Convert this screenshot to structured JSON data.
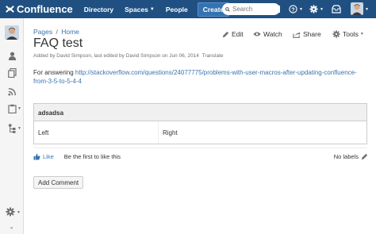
{
  "topnav": {
    "logo_text": "Confluence",
    "directory": "Directory",
    "spaces": "Spaces",
    "people": "People",
    "create": "Create",
    "search_placeholder": "Search"
  },
  "breadcrumb": {
    "pages": "Pages",
    "sep": "/",
    "home": "Home"
  },
  "page": {
    "title": "FAQ test",
    "byline": "Added by David Simpson, last edited by David Simpson on Jun 06, 2014",
    "translate": "Translate"
  },
  "actions": {
    "edit": "Edit",
    "watch": "Watch",
    "share": "Share",
    "tools": "Tools"
  },
  "content": {
    "prefix": "For answering",
    "link": "http://stackoverflow.com/questions/24077775/problems-with-user-macros-after-updating-confluence-from-3-5-to-5-4-4"
  },
  "table": {
    "header": "adsadsa",
    "left": "Left",
    "right": "Right"
  },
  "likes": {
    "like": "Like",
    "first": "Be the first to like this"
  },
  "labels": {
    "no_labels": "No labels"
  },
  "comments": {
    "add": "Add Comment"
  },
  "colors": {
    "topnav_bg": "#205081",
    "link": "#3b73af"
  }
}
